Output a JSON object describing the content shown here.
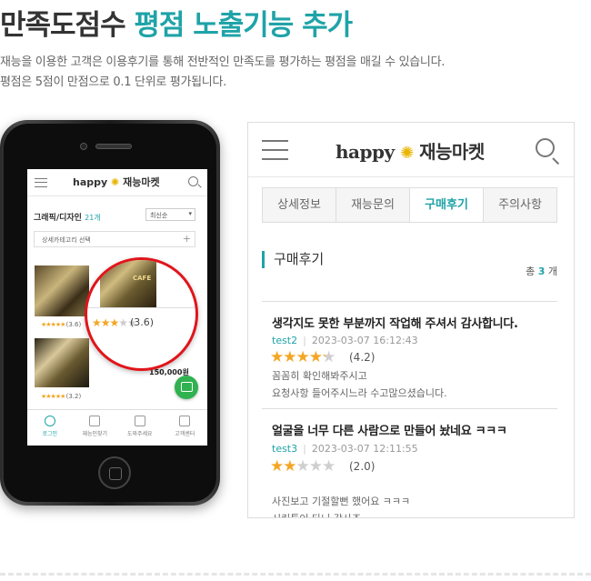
{
  "heading": {
    "part1": "만족도점수",
    "part2": "평점 노출기능 추가"
  },
  "description": [
    "재능을 이용한 고객은 이용후기를 통해 전반적인 만족도를 평가하는 평점을 매길 수 있습니다.",
    "평점은 5점이 만점으로 0.1 단위로 평가됩니다."
  ],
  "colors": {
    "accent": "#1fa3a8",
    "star": "#f4a623",
    "highlight_circle": "#e0151b",
    "chat_fab": "#2fb24f"
  },
  "mobile": {
    "logo_en": "happy",
    "logo_ko": "재능마켓",
    "category": "그래픽/디자인",
    "category_count": "21개",
    "sort_value": "최신순",
    "subcategory_placeholder": "상세카테고리 선택",
    "card1_score": "(3.6)",
    "card2_score": "(3.2)",
    "card2_price": "150,000",
    "card2_price_unit": "원",
    "magnified_score": "(3.6)",
    "magnified_rating": 3.6,
    "magnified_img_text": "CAFE",
    "tabs": [
      {
        "label": "로그인",
        "icon": "user-icon"
      },
      {
        "label": "재능인찾기",
        "icon": "hand-icon"
      },
      {
        "label": "도와주세요",
        "icon": "edit-icon"
      },
      {
        "label": "고객센터",
        "icon": "book-icon"
      }
    ]
  },
  "panel": {
    "logo_en": "happy",
    "logo_ko": "재능마켓",
    "tabs": [
      "상세정보",
      "재능문의",
      "구매후기",
      "주의사항"
    ],
    "active_tab": "구매후기",
    "section_title": "구매후기",
    "total_prefix": "총",
    "total_count": "3",
    "total_suffix": "개",
    "reviews": [
      {
        "title": "생각지도 못한 부분까지 작업해 주셔서 감사합니다.",
        "user": "test2",
        "date": "2023-03-07 16:12:43",
        "rating": 4.2,
        "score_text": "(4.2)",
        "body": [
          "꼼꼼히 확인해봐주시고",
          "요청사항 들어주시느라 수고많으셨습니다."
        ]
      },
      {
        "title": "얼굴을 너무 다른 사람으로 만들어 놨네요 ㅋㅋㅋ",
        "user": "test3",
        "date": "2023-03-07 12:11:55",
        "rating": 2.0,
        "score_text": "(2.0)",
        "body": [
          "사진보고 기절할뻔 했어요 ㅋㅋㅋ",
          "시킨투어 타니 감사죠"
        ]
      }
    ]
  }
}
